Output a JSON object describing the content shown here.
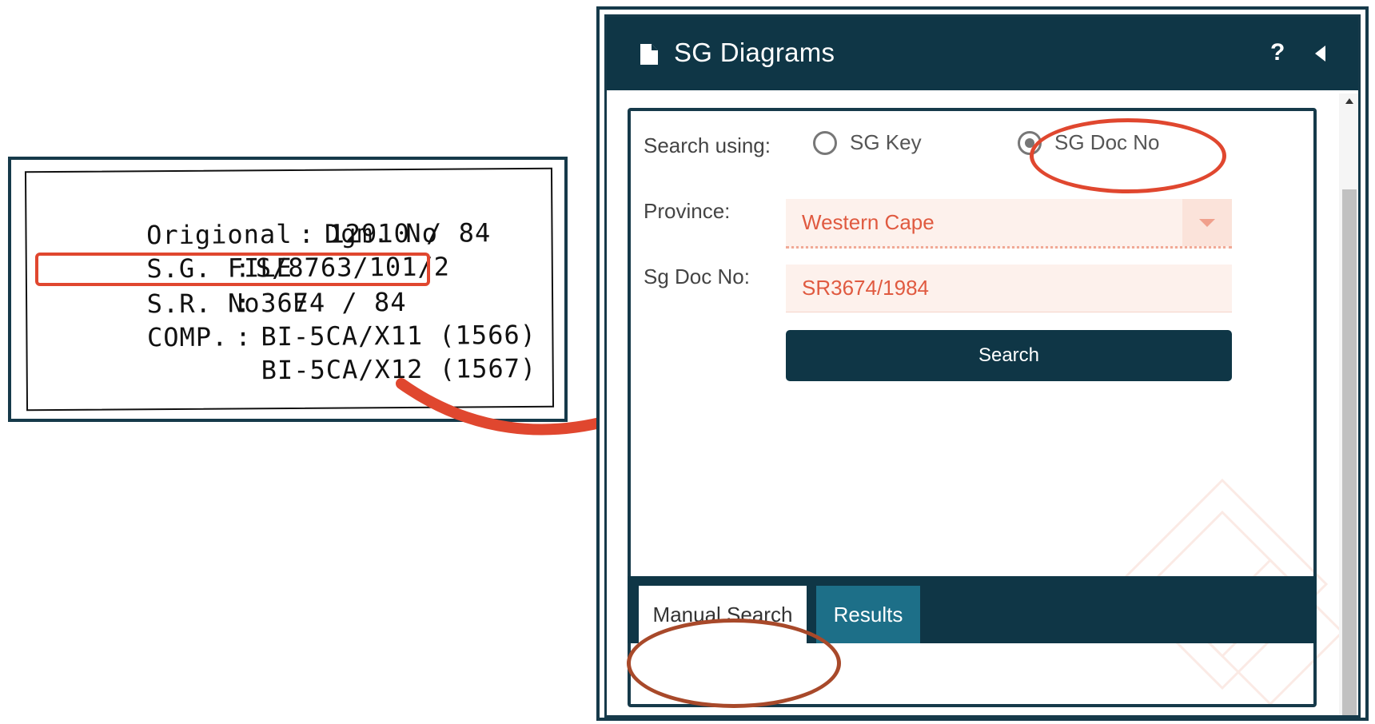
{
  "scan": {
    "rows": [
      {
        "key": "Origional  Dgm. No",
        "colon": ":",
        "value": "12910 / 84"
      },
      {
        "key": "S.G. FILE",
        "colon": ":",
        "value": "S/8763/101/2"
      },
      {
        "key": "S.R. No  E",
        "colon": ":",
        "value": "3674 / 84"
      },
      {
        "key": "COMP.",
        "colon": ":",
        "value": "BI-5CA/X11 (1566)"
      },
      {
        "key": "",
        "colon": "",
        "value": "BI-5CA/X12 (1567)"
      }
    ],
    "highlighted_row": "S.R. No E"
  },
  "panel": {
    "title": "SG Diagrams",
    "icons": {
      "header": "document-icon",
      "help": "help-icon",
      "collapse": "collapse-left-icon"
    },
    "help_glyph": "?"
  },
  "form": {
    "search_using_label": "Search using:",
    "options": [
      {
        "label": "SG Key",
        "checked": false
      },
      {
        "label": "SG Doc No",
        "checked": true
      }
    ],
    "province_label": "Province:",
    "province_value": "Western Cape",
    "doc_no_label": "Sg Doc No:",
    "doc_no_value": "SR3674/1984",
    "search_button": "Search"
  },
  "tabs": [
    {
      "label": "Manual Search",
      "active": true
    },
    {
      "label": "Results",
      "active": false
    }
  ],
  "colors": {
    "primary": "#0f3646",
    "accent": "#e05a40",
    "annotation": "#e0472f",
    "tab_results": "#1d6f88"
  }
}
